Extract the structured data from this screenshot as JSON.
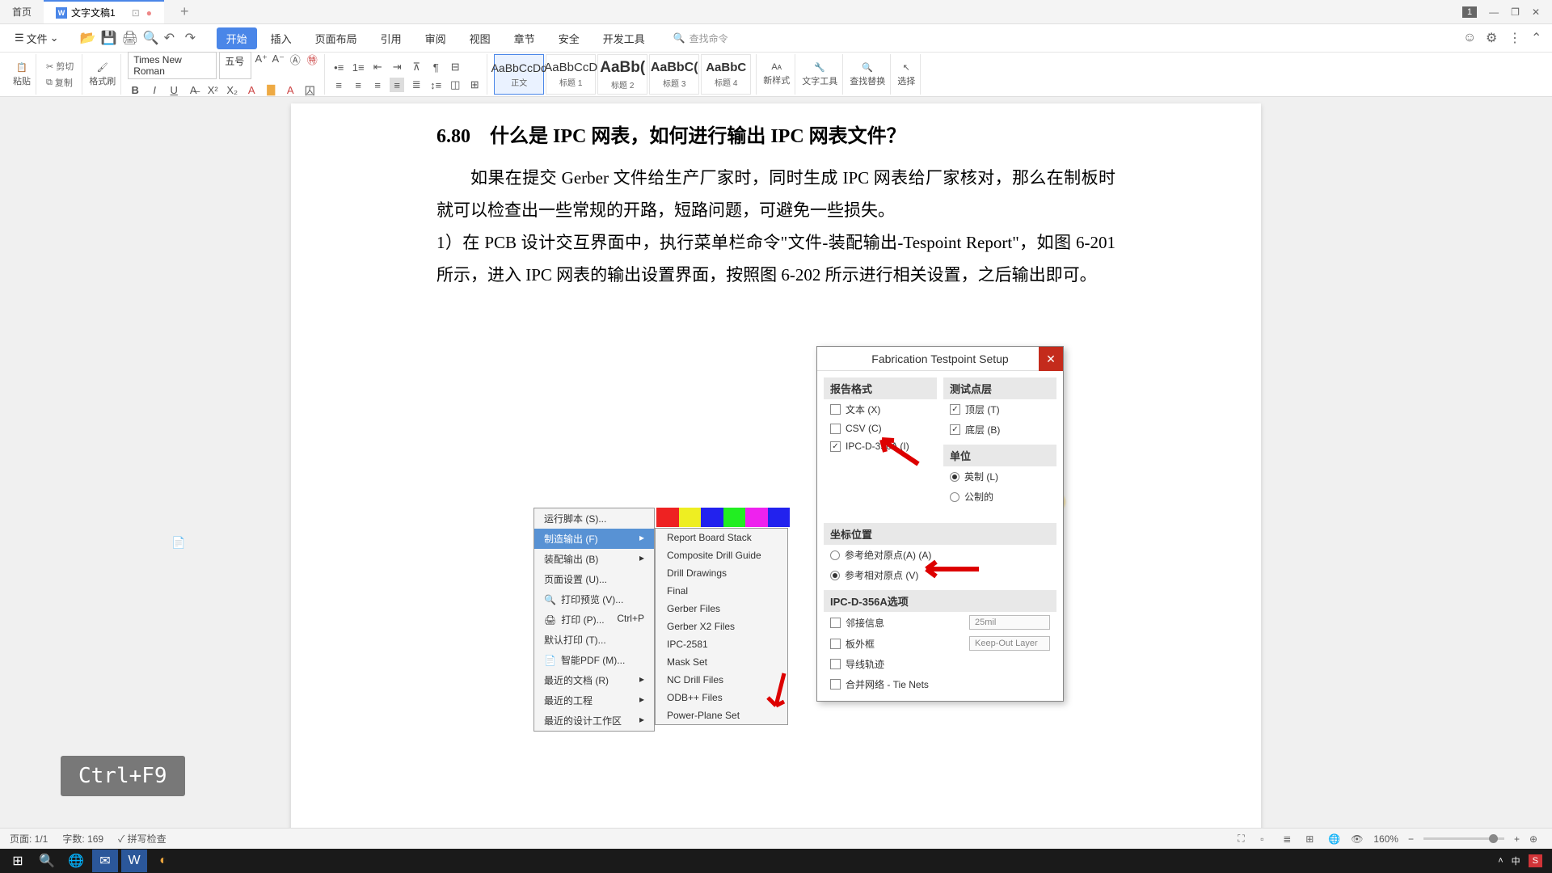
{
  "titlebar": {
    "home_tab": "首页",
    "doc_tab": "文字文稿1",
    "badge": "1"
  },
  "menubar": {
    "file_menu": "文件",
    "tabs": [
      "开始",
      "插入",
      "页面布局",
      "引用",
      "审阅",
      "视图",
      "章节",
      "安全",
      "开发工具"
    ],
    "active_tab": 0,
    "search_placeholder": "查找命令"
  },
  "toolbar": {
    "paste": "粘贴",
    "cut": "剪切",
    "copy": "复制",
    "format_painter": "格式刷",
    "font_name": "Times New Roman",
    "font_size": "五号",
    "styles": [
      {
        "preview": "AaBbCcDd",
        "name": "正文",
        "active": true
      },
      {
        "preview": "AaBbCcD",
        "name": "标题 1"
      },
      {
        "preview": "AaBb(",
        "name": "标题 2"
      },
      {
        "preview": "AaBbC(",
        "name": "标题 3"
      },
      {
        "preview": "AaBbC",
        "name": "标题 4"
      }
    ],
    "new_style": "新样式",
    "text_tools": "文字工具",
    "find_replace": "查找替换",
    "select": "选择"
  },
  "document": {
    "heading": "6.80　什么是 IPC 网表，如何进行输出 IPC 网表文件？",
    "p1": "如果在提交 Gerber 文件给生产厂家时，同时生成 IPC 网表给厂家核对，那么在制板时就可以检查出一些常规的开路，短路问题，可避免一些损失。",
    "p2": "1）在 PCB 设计交互界面中，执行菜单栏命令\"文件-装配输出-Tespoint Report\"，如图 6-201 所示，进入 IPC 网表的输出设置界面，按照图 6-202 所示进行相关设置，之后输出即可。"
  },
  "context_menu": {
    "items": [
      {
        "label": "运行脚本 (S)..."
      },
      {
        "label": "制造输出 (F)",
        "highlighted": true,
        "arrow": true
      },
      {
        "label": "装配输出 (B)",
        "arrow": true
      },
      {
        "label": "页面设置 (U)..."
      },
      {
        "label": "打印预览 (V)..."
      },
      {
        "label": "打印 (P)...",
        "shortcut": "Ctrl+P"
      },
      {
        "label": "默认打印 (T)..."
      },
      {
        "label": "智能PDF (M)..."
      },
      {
        "label": "最近的文档 (R)",
        "arrow": true
      },
      {
        "label": "最近的工程",
        "arrow": true
      },
      {
        "label": "最近的设计工作区",
        "arrow": true
      }
    ],
    "submenu": [
      "Report Board Stack",
      "Composite Drill Guide",
      "Drill Drawings",
      "Final",
      "Gerber Files",
      "Gerber X2 Files",
      "IPC-2581",
      "Mask Set",
      "NC Drill Files",
      "ODB++ Files",
      "Power-Plane Set"
    ]
  },
  "dialog": {
    "title": "Fabrication Testpoint Setup",
    "sec_report": "报告格式",
    "opt_text": "文本 (X)",
    "opt_csv": "CSV (C)",
    "opt_ipc": "IPC-D-356A (I)",
    "sec_layers": "测试点层",
    "opt_top": "顶层 (T)",
    "opt_bottom": "底层 (B)",
    "sec_units": "单位",
    "opt_imperial": "英制 (L)",
    "opt_metric": "公制的",
    "sec_coord": "坐标位置",
    "opt_abs": "参考绝对原点(A) (A)",
    "opt_rel": "参考相对原点 (V)",
    "sec_ipc_opts": "IPC-D-356A选项",
    "opt_neighbor": "邻接信息",
    "opt_board": "板外框",
    "opt_trace": "导线轨迹",
    "opt_merge": "合并网络 - Tie Nets",
    "inp_dist": "25mil",
    "inp_keepout": "Keep-Out Layer"
  },
  "shortcut": "Ctrl+F9",
  "statusbar": {
    "page": "页面: 1/1",
    "words": "字数: 169",
    "spell": "拼写检查",
    "zoom": "160%"
  },
  "taskbar": {
    "ime": "中"
  }
}
